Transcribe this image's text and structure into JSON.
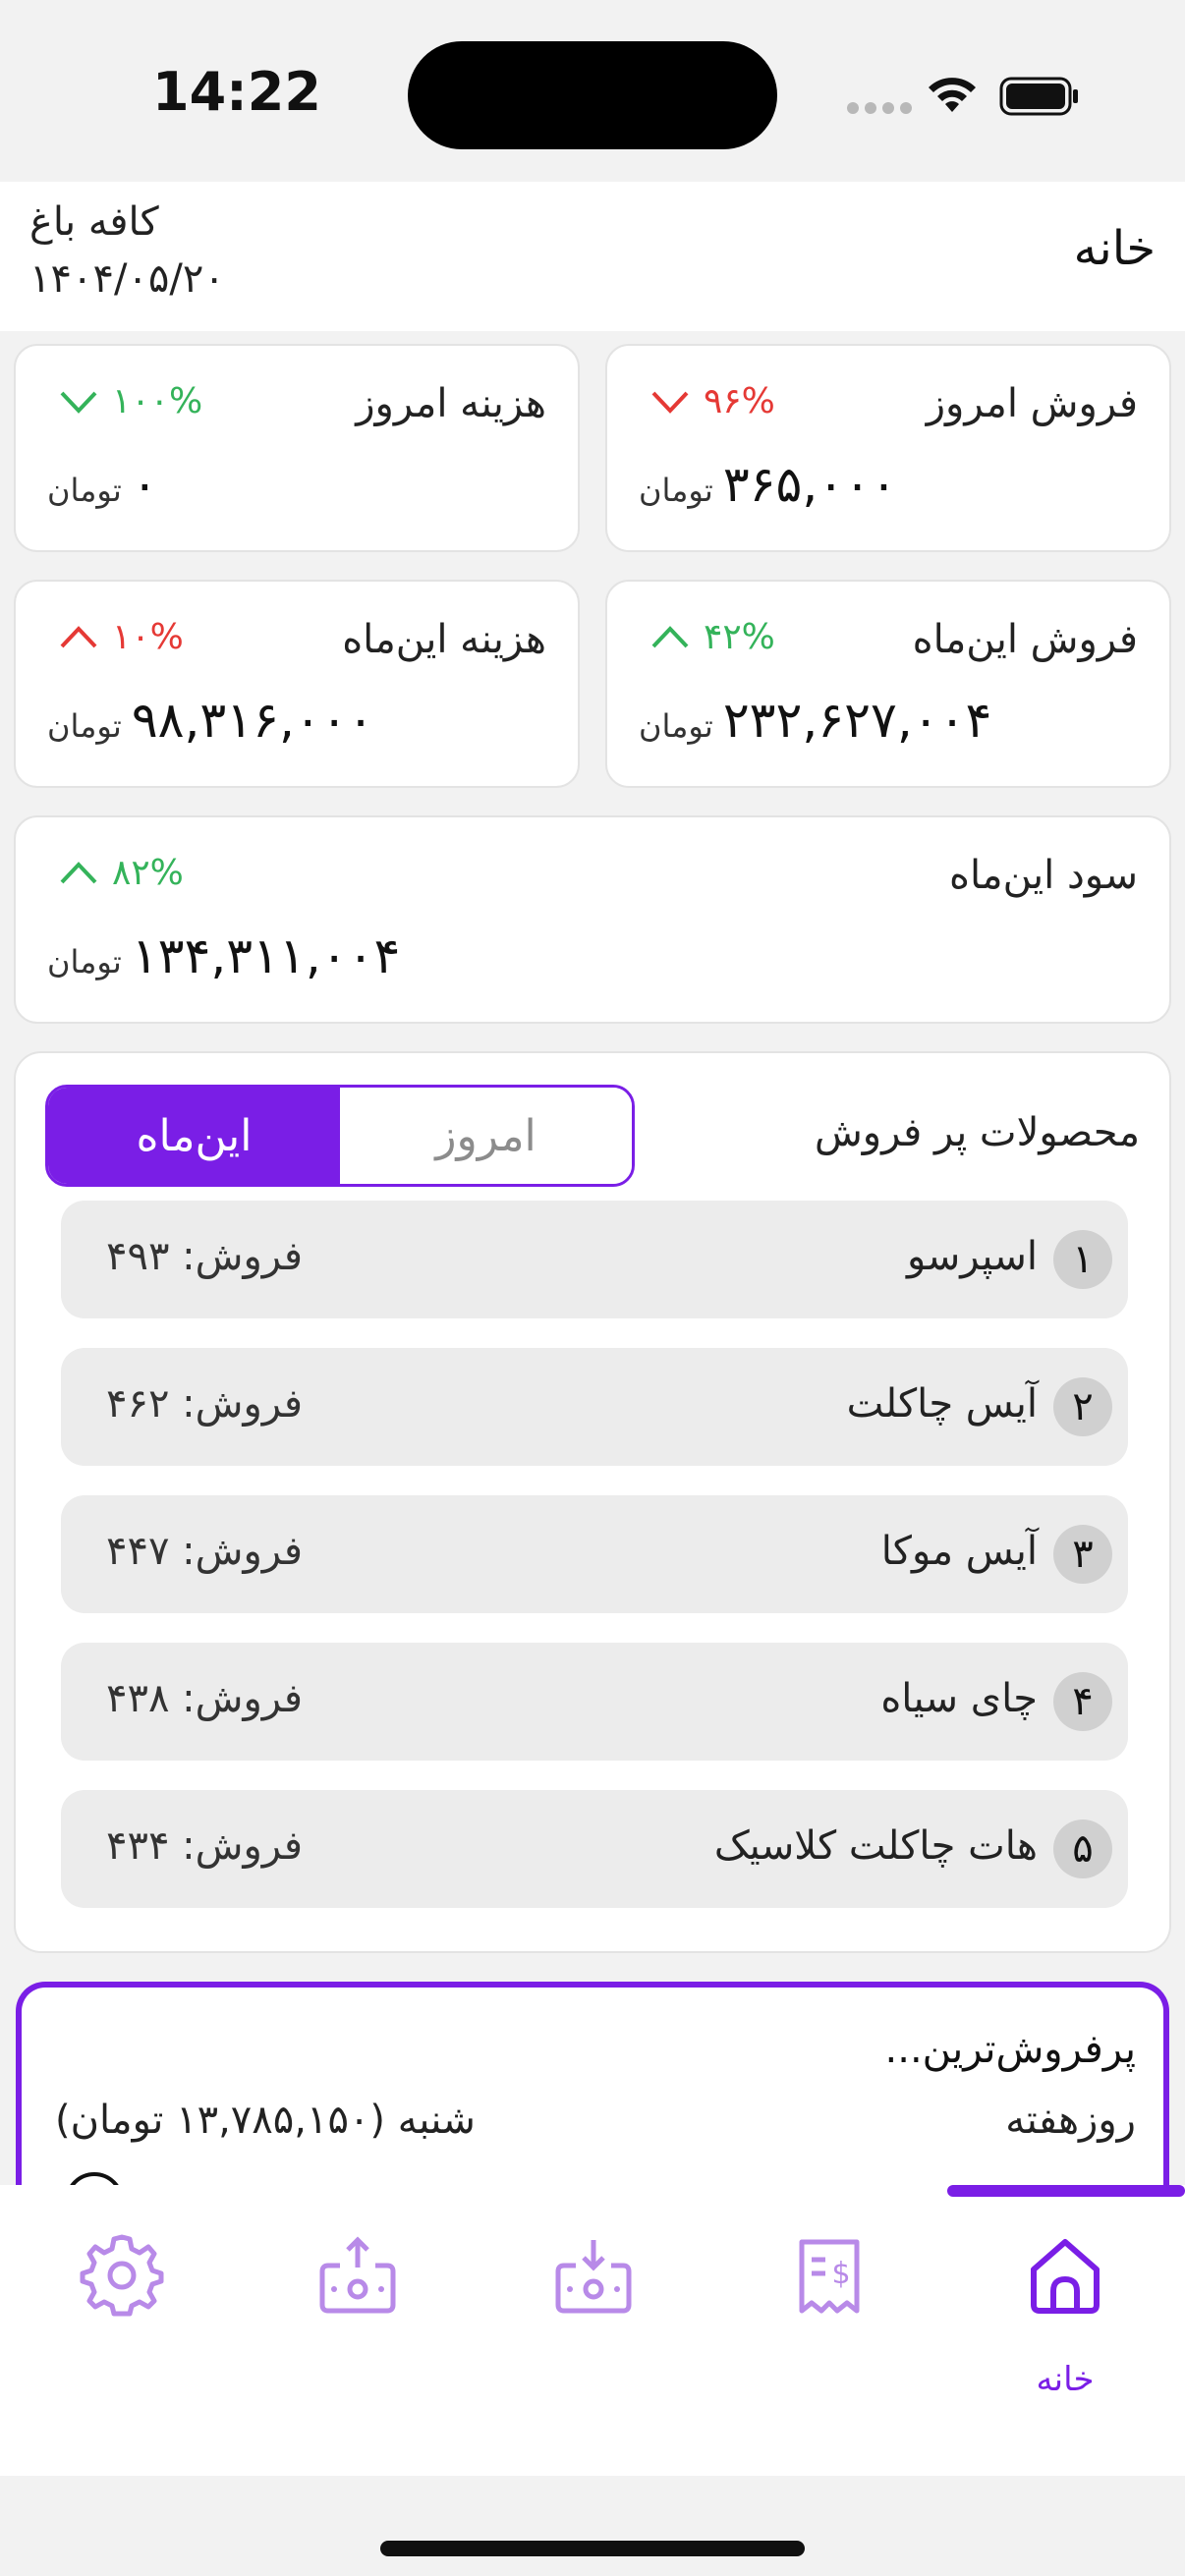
{
  "status_bar": {
    "time": "14:22"
  },
  "header": {
    "title": "خانه",
    "cafe_name": "کافه باغ",
    "date": "۱۴۰۴/۰۵/۲۰"
  },
  "cards": {
    "sales_today": {
      "label": "فروش امروز",
      "change": "۹۶%",
      "direction": "down",
      "amount": "۳۶۵,۰۰۰",
      "unit": "تومان"
    },
    "cost_today": {
      "label": "هزینه امروز",
      "change": "۱۰۰%",
      "direction": "down-arrow-green",
      "amount": "۰",
      "unit": "تومان"
    },
    "sales_month": {
      "label": "فروش این‌ماه",
      "change": "۴۲%",
      "direction": "up",
      "amount": "۲۳۲,۶۲۷,۰۰۴",
      "unit": "تومان"
    },
    "cost_month": {
      "label": "هزینه این‌ماه",
      "change": "۱۰%",
      "direction": "up",
      "amount": "۹۸,۳۱۶,۰۰۰",
      "unit": "تومان"
    },
    "profit_month": {
      "label": "سود این‌ماه",
      "change": "۸۲%",
      "direction": "up",
      "amount": "۱۳۴,۳۱۱,۰۰۴",
      "unit": "تومان"
    }
  },
  "top_products": {
    "title": "محصولات پر فروش",
    "tabs": {
      "today": "امروز",
      "month": "این‌ماه"
    },
    "active_tab": "month",
    "items": [
      {
        "rank": "۱",
        "name": "اسپرسو",
        "sales": "فروش: ۴۹۳"
      },
      {
        "rank": "۲",
        "name": "آیس چاکلت",
        "sales": "فروش: ۴۶۲"
      },
      {
        "rank": "۳",
        "name": "آیس موکا",
        "sales": "فروش: ۴۴۷"
      },
      {
        "rank": "۴",
        "name": "چای سیاه",
        "sales": "فروش: ۴۳۸"
      },
      {
        "rank": "۵",
        "name": "هات چاکلت کلاسیک",
        "sales": "فروش: ۴۳۴"
      }
    ]
  },
  "best_day": {
    "title": "پرفروش‌ترین...",
    "label": "روزهفته",
    "value": "شنبه  (۱۳,۷۸۵,۱۵۰ تومان)"
  },
  "tabbar": {
    "home_label": "خانه",
    "accent": "#7a1ee6",
    "icons": [
      "home-icon",
      "receipt-icon",
      "deposit-icon",
      "withdraw-icon",
      "settings-icon"
    ]
  },
  "colors": {
    "accent": "#7a1ee6",
    "up": "#34b35a",
    "down": "#e53935"
  }
}
